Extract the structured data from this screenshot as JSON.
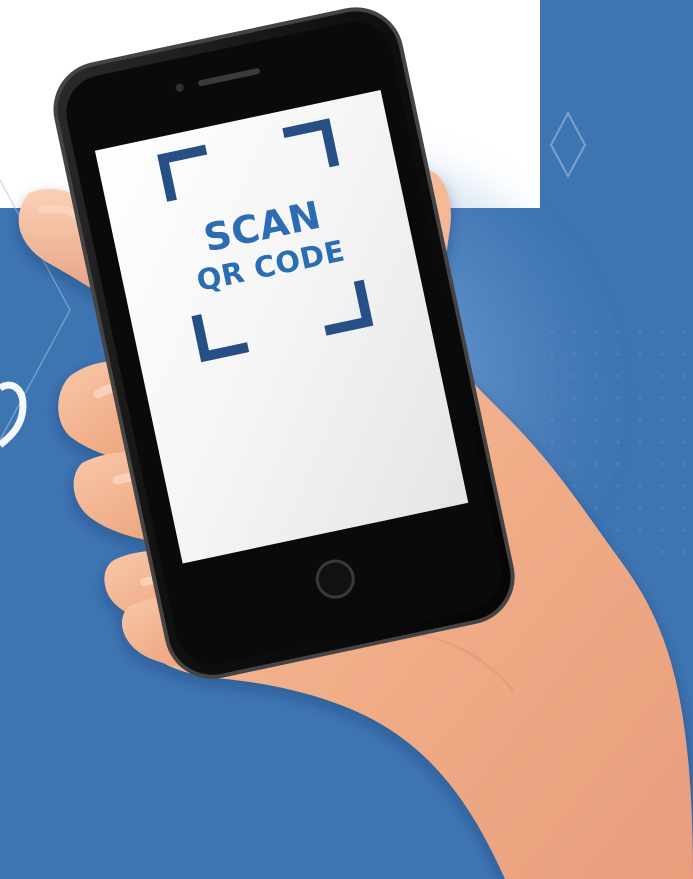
{
  "screen": {
    "line_1": "SCAN",
    "line_2": "QR CODE"
  },
  "colors": {
    "background_blue": "#3d74b2",
    "frame_blue": "#254f85",
    "text_blue": "#2b6db4",
    "phone_black": "#111111",
    "skin": "#f1b38f",
    "white_panel": "#ffffff"
  },
  "icons": {
    "camera": "front-camera-icon",
    "speaker": "phone-speaker-icon",
    "home_button": "phone-home-button-icon",
    "scan_frame": "qr-scan-frame-icon"
  }
}
